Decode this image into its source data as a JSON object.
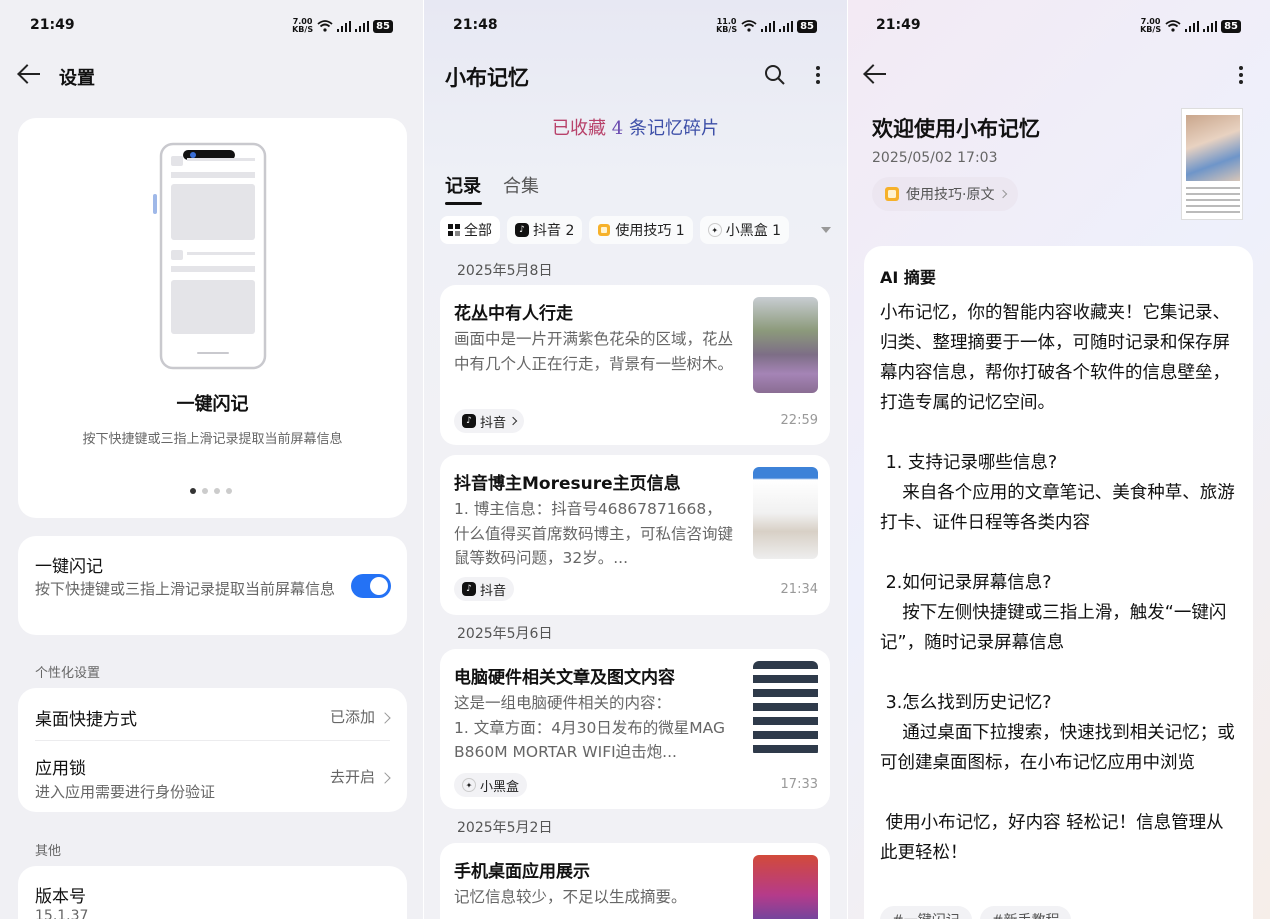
{
  "colors": {
    "accent": "#2472f5",
    "panel_bg": "#f0f0f4"
  },
  "settings": {
    "status": {
      "time": "21:49",
      "speed": "7.00\nKB/S",
      "signal1": "5G",
      "signal2": "5G",
      "battery": "85"
    },
    "title": "设置",
    "onboarding": {
      "title": "一键闪记",
      "desc": "按下快捷键或三指上滑记录提取当前屏幕信息"
    },
    "flash": {
      "title": "一键闪记",
      "desc": "按下快捷键或三指上滑记录提取当前屏幕信息",
      "enabled": true
    },
    "section_personal": "个性化设置",
    "shortcut": {
      "label": "桌面快捷方式",
      "value": "已添加"
    },
    "applock": {
      "label": "应用锁",
      "desc": "进入应用需要进行身份验证",
      "value": "去开启"
    },
    "section_other": "其他",
    "version": {
      "label": "版本号",
      "value": "15.1.37"
    }
  },
  "memory": {
    "status": {
      "time": "21:48",
      "speed": "11.0\nKB/S",
      "signal1": "5G",
      "signal2": "5G",
      "battery": "85"
    },
    "title": "小布记忆",
    "banner": {
      "pre": "已收藏 ",
      "num": "4",
      "post": " 条记忆碎片"
    },
    "tabs": [
      "记录",
      "合集"
    ],
    "chips": [
      "全部",
      "抖音 2",
      "使用技巧 1",
      "小黑盒 1"
    ],
    "dates": [
      "2025年5月8日",
      "2025年5月6日",
      "2025年5月2日"
    ],
    "notes": [
      {
        "title": "花丛中有人行走",
        "body": "画面中是一片开满紫色花朵的区域，花丛中有几个人正在行走，背景有一些树木。",
        "source": "抖音",
        "time": "22:59"
      },
      {
        "title": "抖音博主Moresure主页信息",
        "body": "1. 博主信息：抖音号46867871668，什么值得买首席数码博主，可私信咨询键鼠等数码问题，32岁。...",
        "source": "抖音",
        "time": "21:34"
      },
      {
        "title": "电脑硬件相关文章及图文内容",
        "body": "这是一组电脑硬件相关的内容：\n1. 文章方面：4月30日发布的微星MAG B860M MORTAR WIFI迫击炮...",
        "source": "小黑盒",
        "time": "17:33"
      },
      {
        "title": "手机桌面应用展示",
        "body": "记忆信息较少，不足以生成摘要。"
      }
    ]
  },
  "detail": {
    "status": {
      "time": "21:49",
      "speed": "7.00\nKB/S",
      "signal1": "5G",
      "signal2": "5G",
      "battery": "85"
    },
    "title": "欢迎使用小布记忆",
    "date": "2025/05/02 17:03",
    "tag": "使用技巧·原文",
    "ai_heading": "AI 摘要",
    "ai_body": "小布记忆，你的智能内容收藏夹！它集记录、归类、整理摘要于一体，可随时记录和保存屏幕内容信息，帮你打破各个软件的信息壁垒，打造专属的记忆空间。\n\n 1. 支持记录哪些信息?\n    来自各个应用的文章笔记、美食种草、旅游打卡、证件日程等各类内容\n\n 2.如何记录屏幕信息?\n    按下左侧快捷键或三指上滑，触发“一键闪记”，随时记录屏幕信息\n\n 3.怎么找到历史记忆?\n    通过桌面下拉搜索，快速找到相关记忆；或可创建桌面图标，在小布记忆应用中浏览\n\n 使用小布记忆，好内容 轻松记！信息管理从此更轻松！",
    "tags": [
      "#一键闪记",
      "#新手教程"
    ]
  }
}
